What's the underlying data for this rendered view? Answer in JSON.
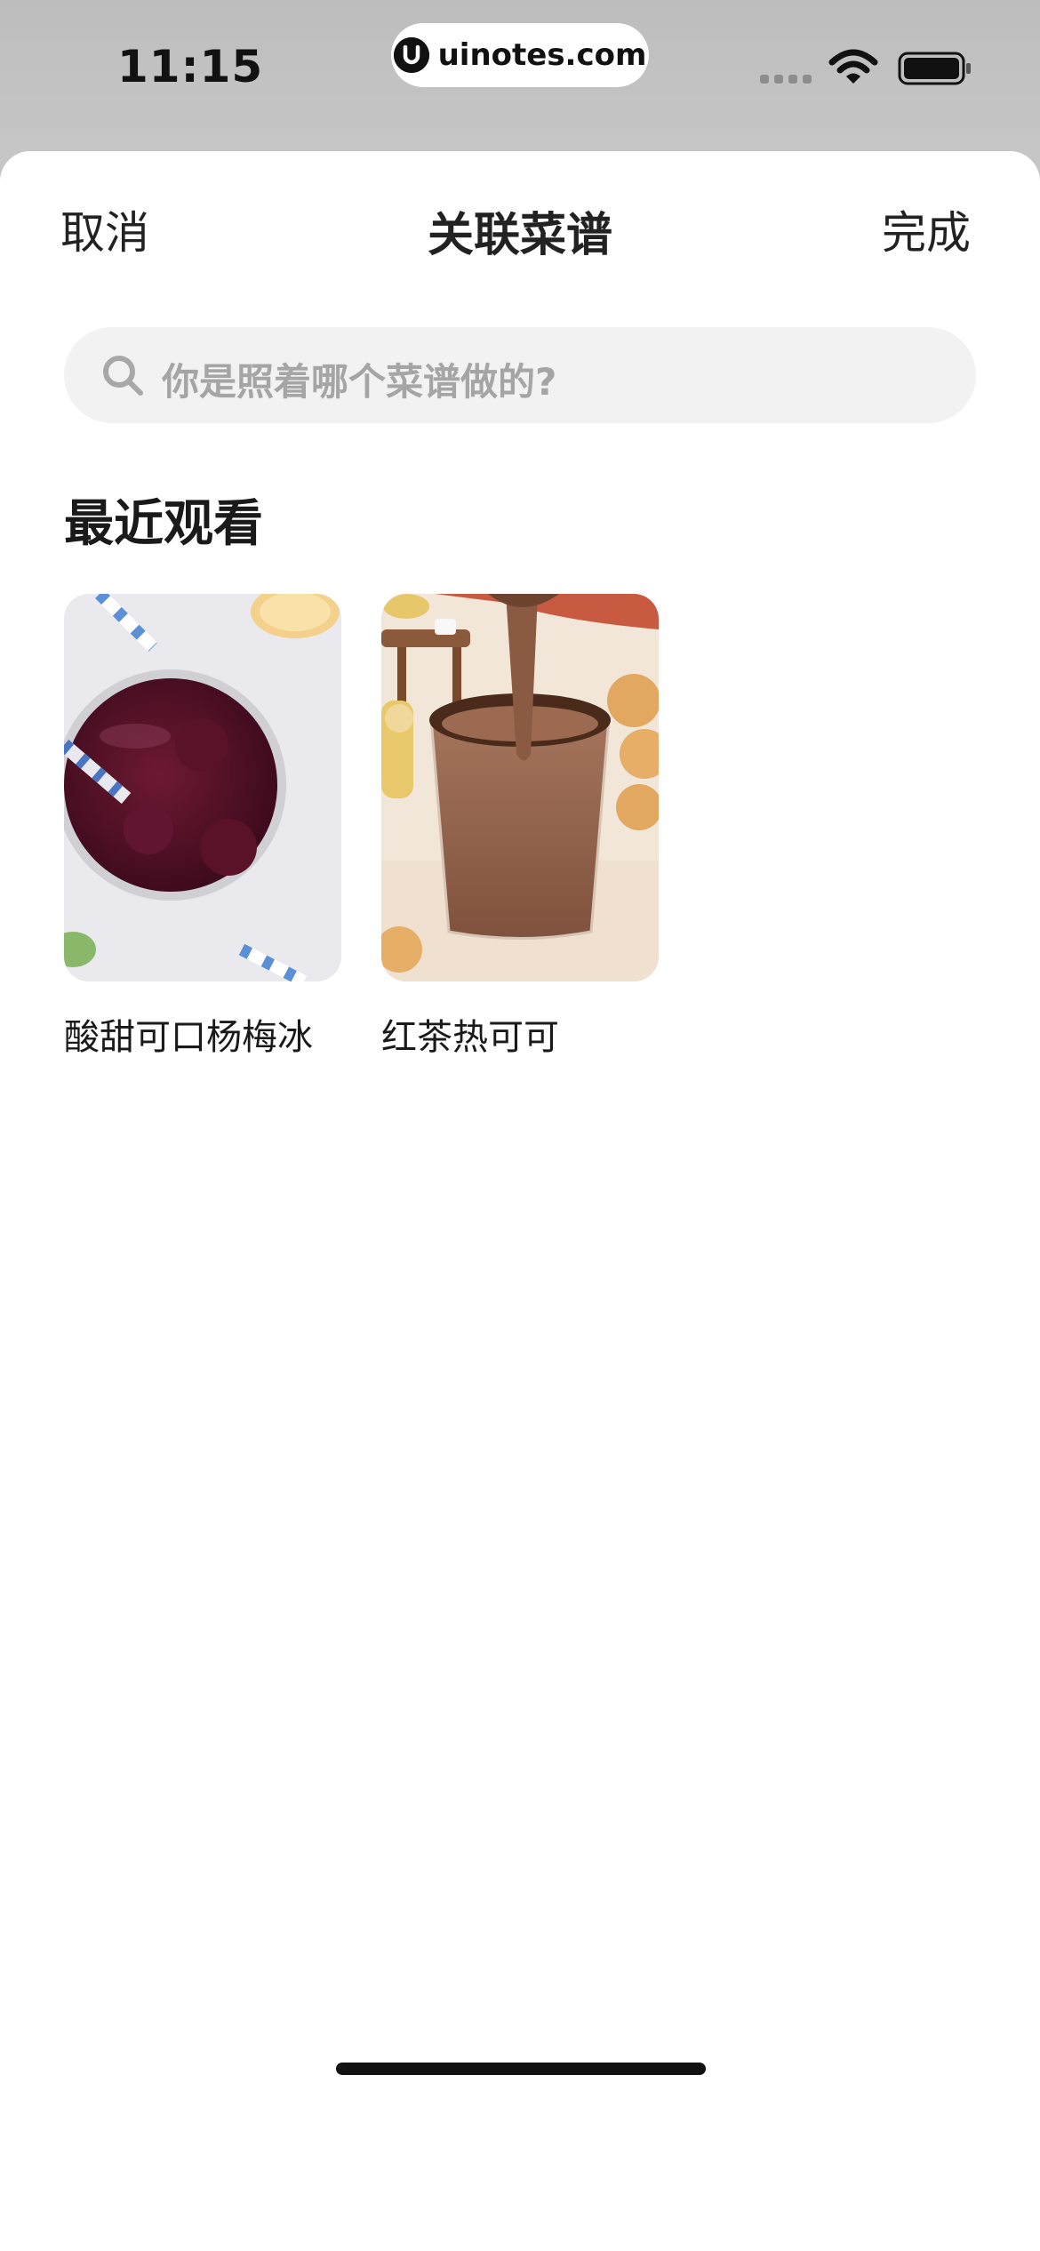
{
  "status_bar": {
    "time": "11:15",
    "url": "uinotes.com",
    "url_logo_letter": "U"
  },
  "nav": {
    "cancel_label": "取消",
    "title": "关联菜谱",
    "done_label": "完成"
  },
  "search": {
    "placeholder": "你是照着哪个菜谱做的?"
  },
  "recent": {
    "section_title": "最近观看",
    "items": [
      {
        "label": "酸甜可口杨梅冰",
        "image": "bayberry-ice-drink-photo"
      },
      {
        "label": "红茶热可可",
        "image": "hot-cocoa-photo"
      }
    ]
  },
  "colors": {
    "sheet_background": "#ffffff",
    "search_background": "#f2f2f2",
    "placeholder_text": "#a5a5a5",
    "primary_text": "#1a1a1a"
  }
}
